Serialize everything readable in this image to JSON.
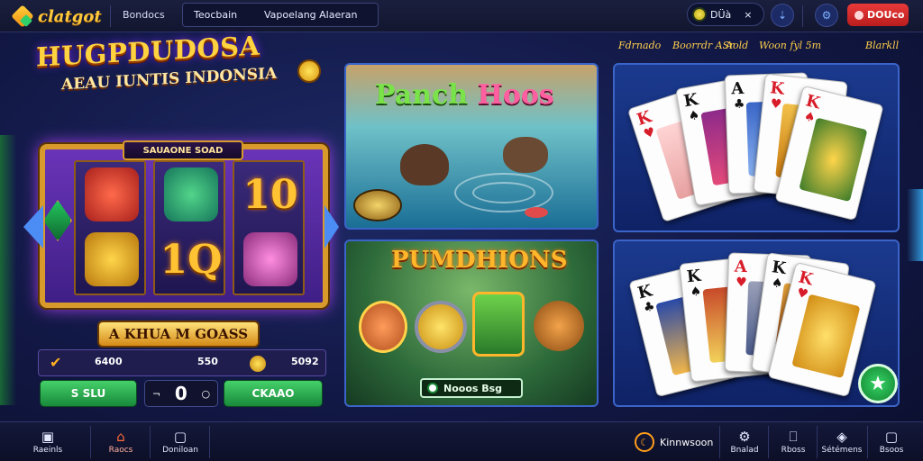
{
  "header": {
    "logo_text": "clatgot",
    "nav_label": "Bondocs",
    "search_tabs": [
      "Teocbain",
      "Vapoelang Alaeran"
    ],
    "balance_label": "DÜà",
    "balance_close": "×",
    "gift_label": "DOUco",
    "nav_arrow_glyph": "⇣",
    "settings_glyph": "⚙"
  },
  "subbar": {
    "items": [
      "Fdrnado",
      "Boorrdr ASr",
      "Aold",
      "Woon fyl 5m",
      "Blarkll"
    ]
  },
  "slot_game": {
    "title": "HUGPDUDOSA",
    "subtitle": "AEAU IUNTIS INDONSIA",
    "reel_badge": "SAUAONE SOAD",
    "symbols": [
      "10",
      "1Q"
    ],
    "bet_banner": "A KHUA M GOASS",
    "bet_values": [
      "6400",
      "550",
      "5092"
    ],
    "controls": {
      "left_label": "S SLU",
      "stepper_value": "0",
      "stepper_prefix": "¬",
      "stepper_suffix": "○",
      "right_label": "CKAAO"
    }
  },
  "games": [
    {
      "title_a": "Panch",
      "title_b": "Hoos"
    },
    {
      "title": "PUMDHIONS",
      "play_label": "Nooos Bsg"
    }
  ],
  "cards_top": [
    {
      "rank": "K",
      "suit": "♥",
      "color": "red"
    },
    {
      "rank": "K",
      "suit": "♠",
      "color": "blk"
    },
    {
      "rank": "A",
      "suit": "♣",
      "color": "blk"
    },
    {
      "rank": "K",
      "suit": "♥",
      "color": "red"
    },
    {
      "rank": "K",
      "suit": "♠",
      "color": "red"
    }
  ],
  "cards_bottom": [
    {
      "rank": "K",
      "suit": "♣",
      "color": "blk"
    },
    {
      "rank": "K",
      "suit": "♠",
      "color": "blk"
    },
    {
      "rank": "A",
      "suit": "♥",
      "color": "red"
    },
    {
      "rank": "K",
      "suit": "♠",
      "color": "blk"
    },
    {
      "rank": "K",
      "suit": "♥",
      "color": "red"
    }
  ],
  "bottom_nav": {
    "items": [
      {
        "label": "Raeinls",
        "icon": "▣"
      },
      {
        "label": "Raocs",
        "icon": "⌂"
      },
      {
        "label": "Doniloan",
        "icon": "▢"
      }
    ],
    "promo_label": "Kinnwsoon",
    "promo_icon": "☾",
    "right_items": [
      {
        "label": "Bnalad",
        "icon": "⚙"
      },
      {
        "label": "Rboss",
        "icon": "⎕"
      },
      {
        "label": "Sétémens",
        "icon": "◈"
      },
      {
        "label": "Bsoos",
        "icon": "▢"
      }
    ]
  },
  "colors": {
    "accent_gold": "#ffd23f",
    "brand_green": "#2fd06a",
    "gift_red": "#e23030",
    "tile_border": "#3a64c8"
  }
}
